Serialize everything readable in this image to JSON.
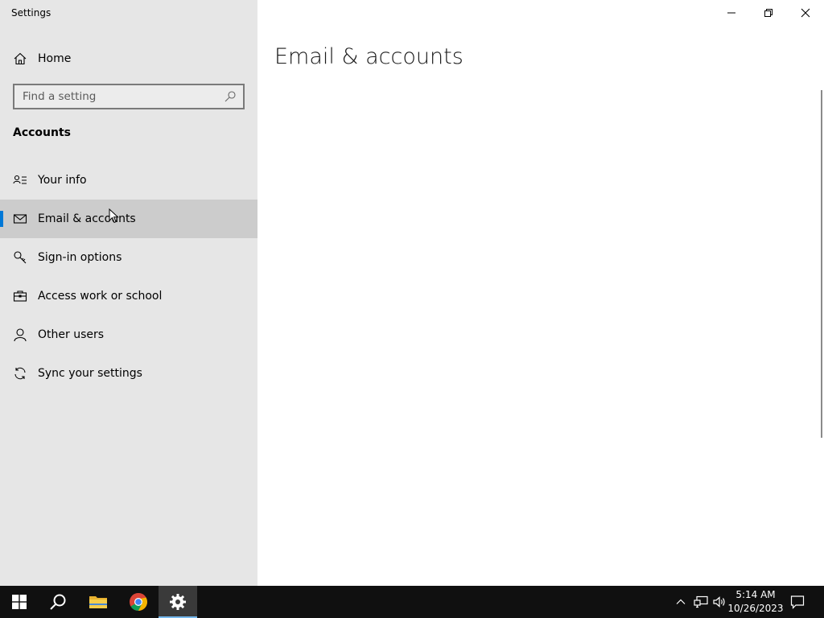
{
  "window": {
    "app_title": "Settings"
  },
  "sidebar": {
    "home_label": "Home",
    "search": {
      "placeholder": "Find a setting"
    },
    "section_heading": "Accounts",
    "items": [
      {
        "label": "Your info",
        "icon": "person-card-icon",
        "selected": false
      },
      {
        "label": "Email & accounts",
        "icon": "mail-icon",
        "selected": true
      },
      {
        "label": "Sign-in options",
        "icon": "key-icon",
        "selected": false
      },
      {
        "label": "Access work or school",
        "icon": "briefcase-icon",
        "selected": false
      },
      {
        "label": "Other users",
        "icon": "person-icon",
        "selected": false
      },
      {
        "label": "Sync your settings",
        "icon": "sync-icon",
        "selected": false
      }
    ]
  },
  "main": {
    "page_title": "Email & accounts"
  },
  "taskbar": {
    "pinned": [
      {
        "name": "start-button",
        "icon": "windows-logo-icon"
      },
      {
        "name": "search-button",
        "icon": "search-icon"
      },
      {
        "name": "file-explorer-button",
        "icon": "folder-icon"
      },
      {
        "name": "chrome-button",
        "icon": "chrome-icon"
      },
      {
        "name": "settings-button",
        "icon": "gear-icon",
        "active": true
      }
    ],
    "clock": {
      "time": "5:14 AM",
      "date": "10/26/2023"
    }
  },
  "colors": {
    "accent": "#0078d7",
    "sidebar_bg": "#e6e6e6",
    "selected_bg": "#cccccc",
    "taskbar_bg": "#101010"
  }
}
